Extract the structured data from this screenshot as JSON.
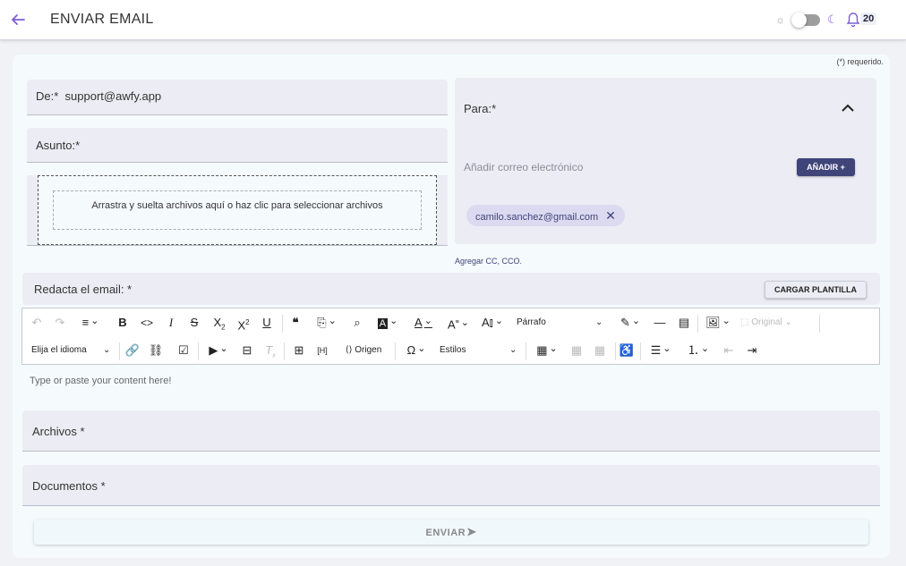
{
  "header": {
    "title": "ENVIAR EMAIL",
    "notifications_count": "20",
    "accent_color": "#7c5cd6"
  },
  "form": {
    "required_note": "(*) requerido.",
    "from_label": "De:*",
    "from_value": "support@awfy.app",
    "subject_label": "Asunto:*",
    "dropzone_text": "Arrastra y suelta archivos aquí o haz clic para seleccionar archivos",
    "to_label": "Para:*",
    "to_placeholder": "Añadir correo electrónico",
    "add_button": "AÑADIR +",
    "recipients": [
      "camilo.sanchez@gmail.com"
    ],
    "cc_link": "Agregar CC, CCO.",
    "compose_label": "Redacta el email: *",
    "template_button": "CARGAR PLANTILLA",
    "editor_placeholder": "Type or paste your content here!",
    "files_label": "Archivos *",
    "documents_label": "Documentos *",
    "send_button": "ENVIAR"
  },
  "toolbar": {
    "paragraph_select": "Párrafo",
    "image_size": "Original",
    "language_select": "Elija el idioma",
    "source_button": "Origen",
    "styles_select": "Estilos"
  },
  "icons": [
    "arrow-left-icon",
    "sun-icon",
    "moon-icon",
    "bell-icon",
    "chevron-up-icon",
    "close-icon",
    "send-icon"
  ]
}
